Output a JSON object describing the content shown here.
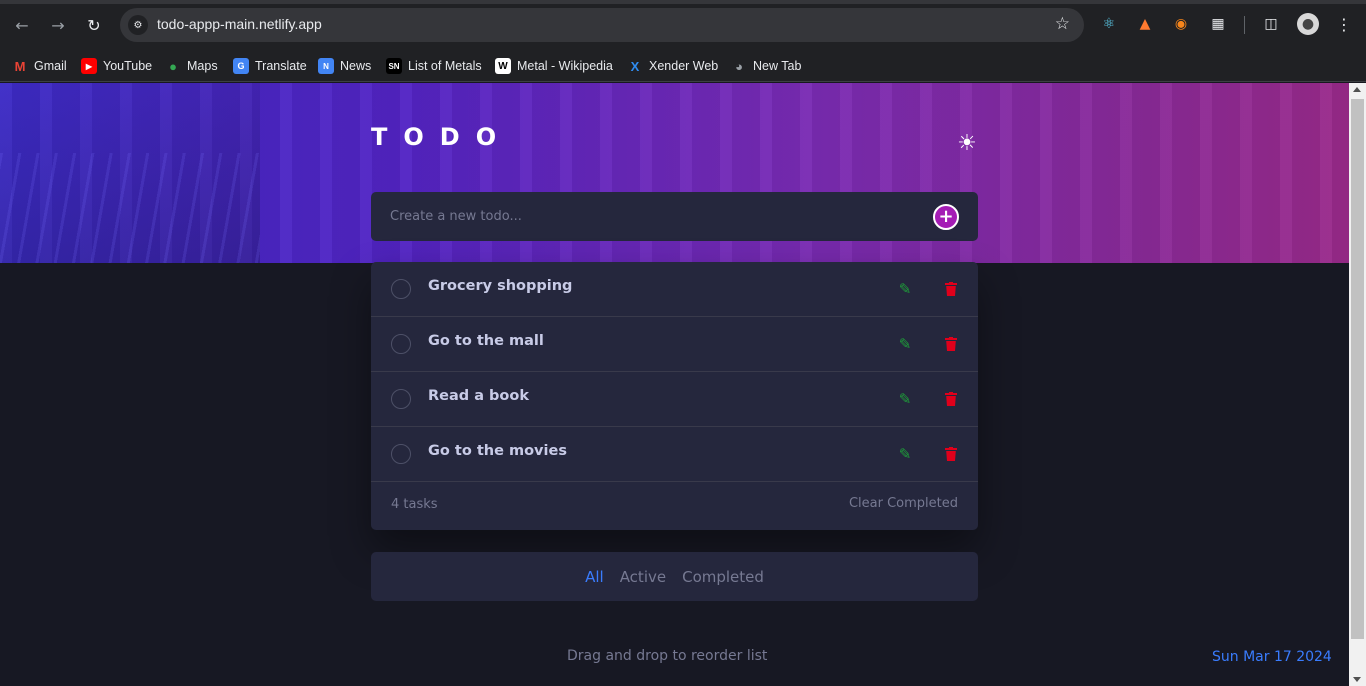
{
  "browser": {
    "url": "todo-appp-main.netlify.app",
    "bookmarks": [
      {
        "label": "Gmail",
        "icon": "gmail-icon",
        "color": "#ea4335"
      },
      {
        "label": "YouTube",
        "icon": "youtube-icon",
        "color": "#ff0000"
      },
      {
        "label": "Maps",
        "icon": "maps-icon",
        "color": "#34a853"
      },
      {
        "label": "Translate",
        "icon": "translate-icon",
        "color": "#4285f4"
      },
      {
        "label": "News",
        "icon": "news-icon",
        "color": "#4285f4"
      },
      {
        "label": "List of Metals",
        "icon": "sn-icon",
        "color": "#111111"
      },
      {
        "label": "Metal - Wikipedia",
        "icon": "wikipedia-icon",
        "color": "#ffffff"
      },
      {
        "label": "Xender Web",
        "icon": "xender-icon",
        "color": "#2f8cf0"
      },
      {
        "label": "New Tab",
        "icon": "globe-icon",
        "color": "#9aa0a6"
      }
    ]
  },
  "app": {
    "title": "TODO",
    "new_todo_placeholder": "Create a new todo...",
    "todos": [
      {
        "text": "Grocery shopping",
        "completed": false
      },
      {
        "text": "Go to the mall",
        "completed": false
      },
      {
        "text": "Read a book",
        "completed": false
      },
      {
        "text": "Go to the movies",
        "completed": false
      }
    ],
    "count_label": "4 tasks",
    "clear_label": "Clear Completed",
    "filters": {
      "all": "All",
      "active": "Active",
      "completed": "Completed",
      "selected": "All"
    },
    "hint": "Drag and drop to reorder list",
    "date": "Sun Mar 17 2024"
  },
  "colors": {
    "accent_blue": "#3a7cfd",
    "add_button": "#a41cb5",
    "edit_icon": "#1f9e3a",
    "delete_icon": "#e0001b"
  }
}
